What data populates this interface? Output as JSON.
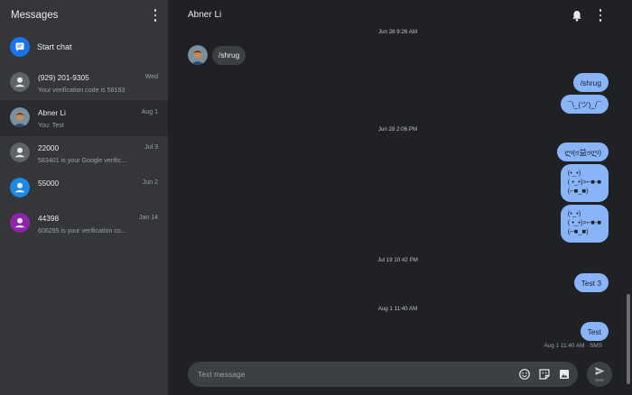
{
  "sidebar": {
    "title": "Messages",
    "start_chat": "Start chat",
    "conversations": [
      {
        "name": "(929) 201-9305",
        "snippet": "Your verification code is 58193",
        "date": "Wed",
        "avatar_color": "#5f6368",
        "avatar_type": "person"
      },
      {
        "name": "Abner Li",
        "snippet": "You: Test",
        "date": "Aug 1",
        "avatar_color": "#c58a5b",
        "avatar_type": "photo"
      },
      {
        "name": "22000",
        "snippet": "583401 is your Google verific...",
        "date": "Jul 3",
        "avatar_color": "#5f6368",
        "avatar_type": "person"
      },
      {
        "name": "55000",
        "snippet": "",
        "date": "Jun 2",
        "avatar_color": "#1e88e5",
        "avatar_type": "person"
      },
      {
        "name": "44398",
        "snippet": "606295 is your verification co...",
        "date": "Jan 14",
        "avatar_color": "#8e24aa",
        "avatar_type": "person"
      }
    ]
  },
  "header": {
    "contact_name": "Abner Li"
  },
  "thread": {
    "timestamps": [
      "Jun 28 9:26 AM",
      "Jun 28 2:06 PM",
      "Jul 19 10:42 PM",
      "Aug 1 11:40 AM"
    ],
    "incoming": [
      {
        "text": "/shrug"
      }
    ],
    "outgoing": [
      {
        "text": "/shrug"
      },
      {
        "text": "¯\\_(ツ)_/¯"
      },
      {
        "text": "ლ(ಠ益ಠლ)"
      },
      {
        "text": "(•_•)\n( •_•)>⌐■-■\n(⌐■_■)"
      },
      {
        "text": "(•_•)\n( •_•)>⌐■-■\n(⌐■_■)"
      },
      {
        "text": "Test 3"
      },
      {
        "text": "Test"
      }
    ],
    "status": "Aug 1 11:40 AM · SMS"
  },
  "composer": {
    "placeholder": "Text message",
    "value": "",
    "send_label": "SMS"
  },
  "colors": {
    "bubble_out": "#8ab4f8",
    "bubble_in": "#3c4043",
    "sidebar": "#35363a",
    "main": "#202124",
    "accent": "#1a73e8"
  }
}
